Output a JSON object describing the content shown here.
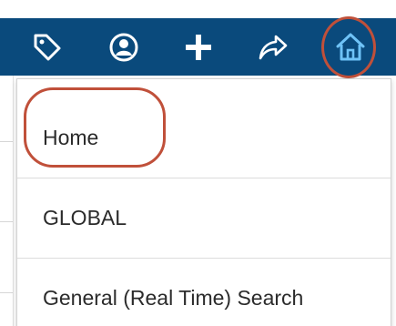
{
  "toolbar": {
    "background_color": "#0a4a7c",
    "icons": [
      {
        "name": "tag-icon"
      },
      {
        "name": "user-icon"
      },
      {
        "name": "plus-icon"
      },
      {
        "name": "share-icon"
      },
      {
        "name": "home-icon",
        "highlighted": true,
        "highlight_color": "#c0503a"
      }
    ]
  },
  "menu": {
    "items": [
      {
        "label": "Home",
        "highlighted": true
      },
      {
        "label": "GLOBAL"
      },
      {
        "label": "General (Real Time) Search"
      }
    ]
  },
  "colors": {
    "annotation": "#c0503a",
    "home_icon": "#6fc3f7"
  }
}
